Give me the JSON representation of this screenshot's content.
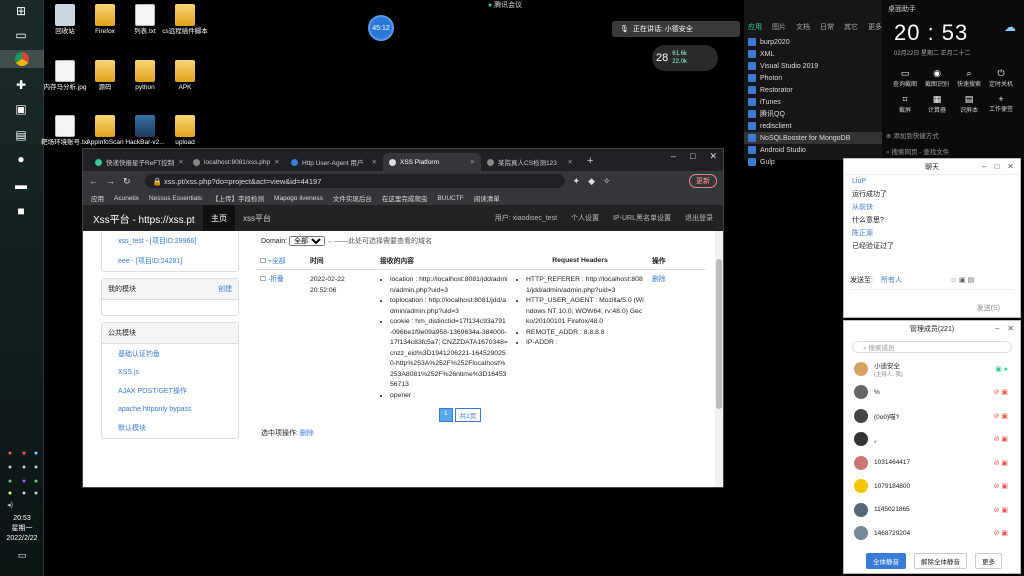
{
  "meeting": {
    "title": "腾讯会议",
    "timer": "45:12",
    "notify": "正在讲话: 小德安全",
    "net_level": "28",
    "net_up": "61.6k",
    "net_down": "22.0k"
  },
  "desktop": [
    {
      "label": "回收站",
      "type": "bin"
    },
    {
      "label": "Firefox",
      "type": "folder"
    },
    {
      "label": "列表.txt",
      "type": "file"
    },
    {
      "label": "cs远程插件脚本",
      "type": "folder"
    },
    {
      "label": "内存马分析.jpg",
      "type": "file"
    },
    {
      "label": "源码",
      "type": "folder"
    },
    {
      "label": "python",
      "type": "folder"
    },
    {
      "label": "APK",
      "type": "folder"
    },
    {
      "label": "靶场环境账号.txt",
      "type": "file"
    },
    {
      "label": "AppInfoScan",
      "type": "folder"
    },
    {
      "label": "HackBar-v2...",
      "type": "exe"
    },
    {
      "label": "upload",
      "type": "folder"
    }
  ],
  "clock": {
    "time": "20:53",
    "weekday": "星期一",
    "date": "2022/2/22"
  },
  "startlist": {
    "tabs": [
      "应用",
      "图片",
      "文档",
      "日常",
      "其它",
      "更多"
    ],
    "apps": [
      "burp2020",
      "XML",
      "Visual Studio 2019",
      "Photon",
      "Restorator",
      "iTunes",
      "腾讯QQ",
      "redisclient",
      "NoSQLBooster for MongoDB",
      "Android Studio",
      "Gulp"
    ]
  },
  "quick": {
    "header": "桌面助手",
    "time": "20 : 53",
    "date": "02月22日  星期二  正月二十二",
    "items": [
      "查询截图",
      "截图识别",
      "快速搜索",
      "定时关机",
      "截屏",
      "计算器",
      "识屏本",
      "工作便签"
    ],
    "search1": "添加到快捷方式",
    "search2": "搜索网页 - 查找文件"
  },
  "browser": {
    "tabs": [
      "快递快报星子ReFT控制",
      "localhost:8081/xss.php",
      "Http User-Agent 用户",
      "XSS Platform",
      "某院真人CS检测123"
    ],
    "win": [
      "–",
      "□",
      "✕"
    ],
    "url": "xss.pt/xss.php?do=project&act=view&id=44197",
    "update": "更新",
    "bookmarks": [
      "应用",
      "Acunetix",
      "Nessus Essentials",
      "【上传】字段检测",
      "Mapogo liveness",
      "文件实现后台",
      "在这里完成爬虫",
      "BUUCTF",
      "阅读清单"
    ],
    "site": {
      "brand": "Xss平台 - https://xss.pt",
      "nav": [
        "主页",
        "xss平台"
      ],
      "user": "用户: xiaodisec_test",
      "links": [
        "个人设置",
        "IP-URL黑名单设置",
        "退出登录"
      ]
    },
    "left": {
      "projects": [
        "xss_test - [项目ID:29966]",
        "eee - [项目ID:24281]"
      ],
      "my_modules": "我的模块",
      "create": "创建",
      "public_modules": "公共模块",
      "modules": [
        "基础认证钓鱼",
        "XSS.js",
        "AJAX POST/GET操作",
        "apache httponly bypass",
        "默认模块"
      ]
    },
    "main": {
      "domain_label": "Domain:",
      "domain_value": "全部",
      "domain_hint": "←——此处可选择需要查看的域名",
      "headers": [
        "+全部",
        "时间",
        "接收的内容",
        "Request Headers",
        "操作"
      ],
      "row": {
        "toggle": "-折叠",
        "time": "2022-02-22 20:52:06",
        "content": [
          "location : http://localhost:8081/jdd/admin/admin.php?uid=3",
          "toplocation : http://localhost:8081/jdd/admin/admin.php?uid=3",
          "cookie : hm_distinctid=17f134c93a791-096be1f9e09a958-1369634a-384000-17f134c83fc5a7; CNZZDATA1670348=cnzz_eid%3D1941206221-1645290250-http%253A%252F%252Flocalhost%253A8081%252F%26ntime%3D1645356713",
          "opener :"
        ],
        "headers": [
          "HTTP_REFERER : http://localhost:8081/jdd/admin/admin.php?uid=3",
          "HTTP_USER_AGENT : Mozilla/5.0 (Windows NT 10.0; WOW64; rv:48.0) Gecko/20100101 Firefox/48.0",
          "REMOTE_ADDR : 8.8.8.8",
          "IP-ADDR :"
        ],
        "action": "删除"
      },
      "pager": [
        "1",
        "共1页"
      ],
      "selop_label": "选中项操作:",
      "selop_action": "删除"
    }
  },
  "chat": {
    "title": "聊天",
    "messages": [
      {
        "u": "LiuP",
        "m": "运行成功了"
      },
      {
        "u": "从前快",
        "m": "什么意思?"
      },
      {
        "u": "陈正源",
        "m": "已经验证过了"
      }
    ],
    "send_label": "发送至:",
    "send_to": "所有人",
    "send_btn": "发送(S)"
  },
  "members": {
    "title": "管理成员(221)",
    "search": "搜索成员",
    "list": [
      {
        "name": "小迪安全",
        "sub": "(主持人, 我)",
        "color": "#d9a066"
      },
      {
        "name": "%",
        "sub": "",
        "color": "#666"
      },
      {
        "name": "(0o0)喵?",
        "sub": "",
        "color": "#444"
      },
      {
        "name": "。",
        "sub": "",
        "color": "#333"
      },
      {
        "name": "1031464417",
        "sub": "",
        "color": "#c77"
      },
      {
        "name": "1079184800",
        "sub": "",
        "color": "#f5c400"
      },
      {
        "name": "1145021865",
        "sub": "",
        "color": "#567"
      },
      {
        "name": "1468729204",
        "sub": "",
        "color": "#789"
      }
    ],
    "foot": [
      "全体静音",
      "解除全体静音",
      "更多"
    ]
  }
}
